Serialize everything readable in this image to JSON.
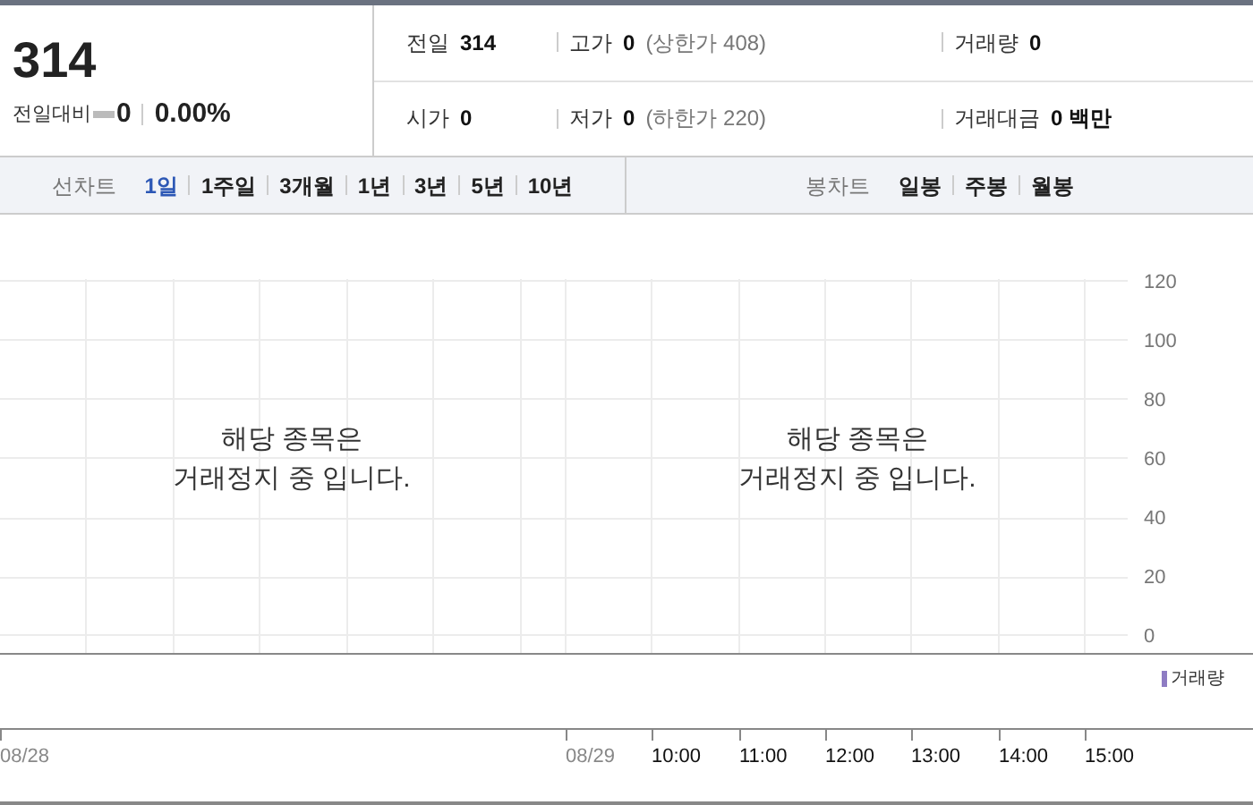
{
  "quote": {
    "price": "314",
    "change_label": "전일대비",
    "change": "0",
    "change_rate": "0.00%"
  },
  "stats": [
    {
      "label": "전일",
      "value": "314"
    },
    {
      "label": "고가",
      "value": "0",
      "note": "(상한가 408)"
    },
    {
      "label": "거래량",
      "value": "0"
    },
    {
      "label": "시가",
      "value": "0"
    },
    {
      "label": "저가",
      "value": "0",
      "note": "(하한가 220)"
    },
    {
      "label": "거래대금",
      "value": "0 백만"
    }
  ],
  "line_chart_tabs": {
    "label": "선차트",
    "items": [
      {
        "label": "1일",
        "selected": true
      },
      {
        "label": "1주일",
        "selected": false
      },
      {
        "label": "3개월",
        "selected": false
      },
      {
        "label": "1년",
        "selected": false
      },
      {
        "label": "3년",
        "selected": false
      },
      {
        "label": "5년",
        "selected": false
      },
      {
        "label": "10년",
        "selected": false
      }
    ]
  },
  "candle_chart_tabs": {
    "label": "봉차트",
    "items": [
      {
        "label": "일봉",
        "selected": false
      },
      {
        "label": "주봉",
        "selected": false
      },
      {
        "label": "월봉",
        "selected": false
      }
    ]
  },
  "chart": {
    "messages": [
      "해당 종목은\n거래정지 중 입니다.",
      "해당 종목은\n거래정지 중 입니다."
    ],
    "y_axis_labels": [
      "120",
      "100",
      "80",
      "60",
      "40",
      "20",
      "0"
    ],
    "volume_legend": "거래량",
    "x_axis_labels": [
      {
        "text": "08/28",
        "kind": "date"
      },
      {
        "text": "08/29",
        "kind": "date"
      },
      {
        "text": "10:00",
        "kind": "time"
      },
      {
        "text": "11:00",
        "kind": "time"
      },
      {
        "text": "12:00",
        "kind": "time"
      },
      {
        "text": "13:00",
        "kind": "time"
      },
      {
        "text": "14:00",
        "kind": "time"
      },
      {
        "text": "15:00",
        "kind": "time"
      }
    ]
  }
}
